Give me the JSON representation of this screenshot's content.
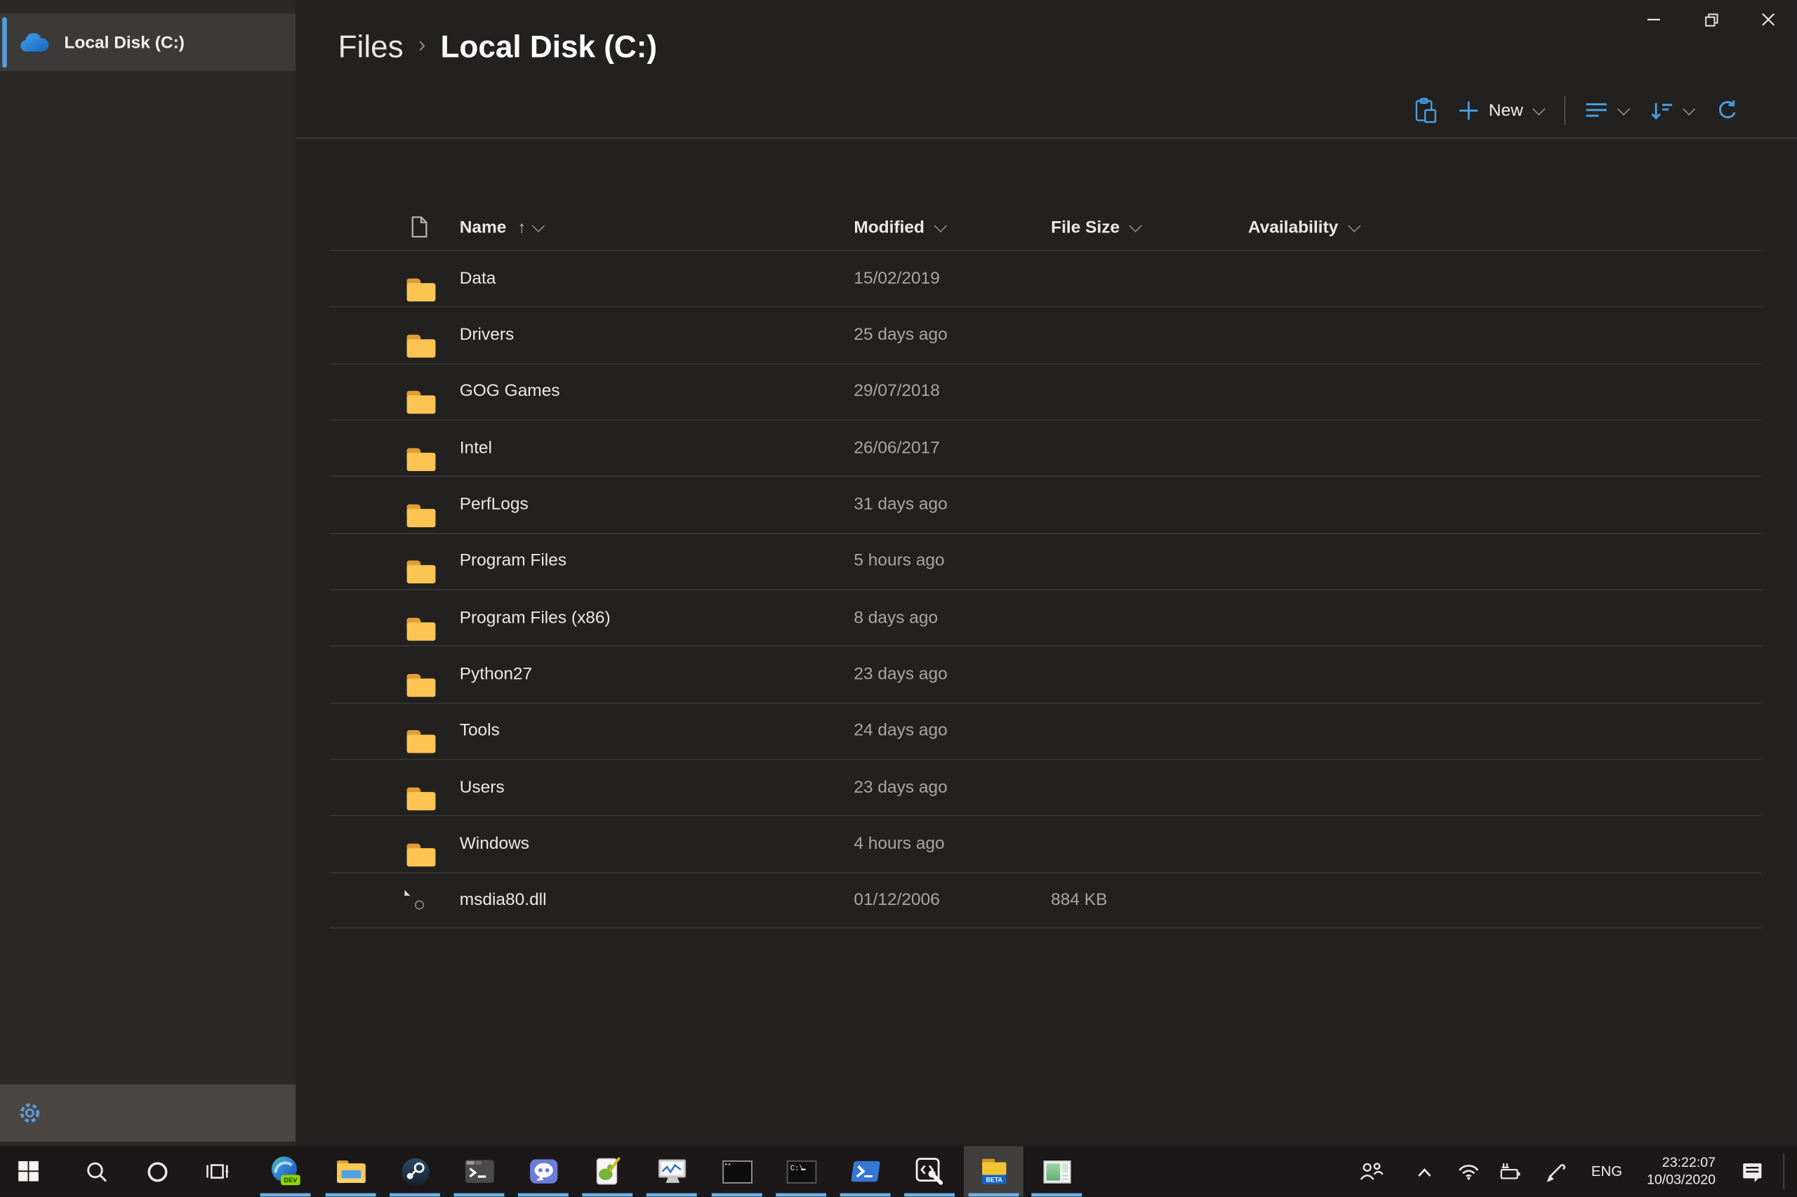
{
  "window": {
    "controls": [
      "minimize",
      "restore",
      "close"
    ]
  },
  "sidebar": {
    "items": [
      {
        "label": "Local Disk (C:)",
        "icon": "onedrive-cloud-icon",
        "selected": true
      }
    ],
    "settings_icon": "gear-icon"
  },
  "breadcrumb": {
    "root": "Files",
    "separator": "›",
    "current": "Local Disk (C:)"
  },
  "toolbar": {
    "new_label": "New",
    "icons": [
      "paste-icon",
      "new-plus-icon",
      "view-options-icon",
      "sort-options-icon",
      "refresh-icon"
    ]
  },
  "table": {
    "sort_arrow": "↑",
    "columns": [
      {
        "label": "Name",
        "sorted": "ascending"
      },
      {
        "label": "Modified"
      },
      {
        "label": "File Size"
      },
      {
        "label": "Availability"
      }
    ],
    "rows": [
      {
        "name": "Data",
        "type": "folder",
        "modified": "15/02/2019",
        "size": "",
        "availability": ""
      },
      {
        "name": "Drivers",
        "type": "folder",
        "modified": "25 days ago",
        "size": "",
        "availability": ""
      },
      {
        "name": "GOG Games",
        "type": "folder",
        "modified": "29/07/2018",
        "size": "",
        "availability": ""
      },
      {
        "name": "Intel",
        "type": "folder",
        "modified": "26/06/2017",
        "size": "",
        "availability": ""
      },
      {
        "name": "PerfLogs",
        "type": "folder",
        "modified": "31 days ago",
        "size": "",
        "availability": ""
      },
      {
        "name": "Program Files",
        "type": "folder",
        "modified": "5 hours ago",
        "size": "",
        "availability": ""
      },
      {
        "name": "Program Files (x86)",
        "type": "folder",
        "modified": "8 days ago",
        "size": "",
        "availability": ""
      },
      {
        "name": "Python27",
        "type": "folder",
        "modified": "23 days ago",
        "size": "",
        "availability": ""
      },
      {
        "name": "Tools",
        "type": "folder",
        "modified": "24 days ago",
        "size": "",
        "availability": ""
      },
      {
        "name": "Users",
        "type": "folder",
        "modified": "23 days ago",
        "size": "",
        "availability": ""
      },
      {
        "name": "Windows",
        "type": "folder",
        "modified": "4 hours ago",
        "size": "",
        "availability": ""
      },
      {
        "name": "msdia80.dll",
        "type": "file",
        "modified": "01/12/2006",
        "size": "884 KB",
        "availability": ""
      }
    ]
  },
  "taskbar": {
    "apps": [
      {
        "name": "start",
        "running": false
      },
      {
        "name": "search",
        "running": false
      },
      {
        "name": "cortana",
        "running": false
      },
      {
        "name": "task-view",
        "running": false
      },
      {
        "name": "edge-dev",
        "running": true
      },
      {
        "name": "file-explorer",
        "running": true
      },
      {
        "name": "steam",
        "running": true
      },
      {
        "name": "terminal",
        "running": true
      },
      {
        "name": "discord",
        "running": true
      },
      {
        "name": "notepad-plus-plus",
        "running": true
      },
      {
        "name": "resource-monitor",
        "running": true
      },
      {
        "name": "console",
        "running": true
      },
      {
        "name": "command-prompt",
        "running": true
      },
      {
        "name": "powershell",
        "running": true
      },
      {
        "name": "dev-tools",
        "running": true
      },
      {
        "name": "files-beta",
        "running": true,
        "active": true
      },
      {
        "name": "system-window",
        "running": true
      }
    ],
    "badges": {
      "edge": "DEV",
      "files": "BETA",
      "cmd": "C:\\"
    },
    "tray": {
      "language": "ENG",
      "time": "23:22:07",
      "date": "10/03/2020"
    }
  },
  "colors": {
    "accent_blue": "#45a0e0",
    "indicator_blue": "#6fb1e4",
    "selection_bg": "#3c3a38",
    "folder_front": "#fcc553",
    "folder_back": "#e09e36",
    "main_bg": "#232020",
    "sidebar_bg": "#2b2928",
    "taskbar_bg": "#1c1819"
  }
}
